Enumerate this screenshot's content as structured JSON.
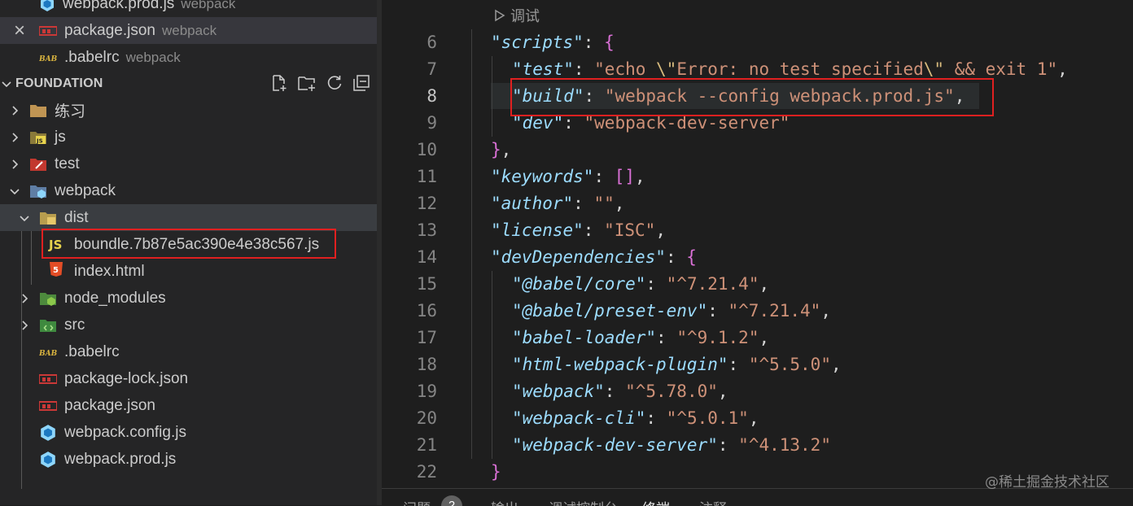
{
  "open_editors": [
    {
      "name": "webpack.prod.js",
      "desc": "webpack",
      "icon": "webpack-file-icon"
    },
    {
      "name": "package.json",
      "desc": "webpack",
      "icon": "npm-file-icon",
      "close": "×"
    },
    {
      "name": ".babelrc",
      "desc": "webpack",
      "icon": "babel-file-icon"
    }
  ],
  "explorer": {
    "title": "FOUNDATION",
    "actions": [
      "new-file-icon",
      "new-folder-icon",
      "refresh-icon",
      "collapse-all-icon"
    ],
    "items": [
      {
        "label": "练习",
        "icon": "folder-icon",
        "expanded": false
      },
      {
        "label": "js",
        "icon": "js-folder-icon",
        "expanded": false
      },
      {
        "label": "test",
        "icon": "test-folder-icon",
        "expanded": false
      },
      {
        "label": "webpack",
        "icon": "webpack-folder-icon",
        "expanded": true
      },
      {
        "label": "dist",
        "icon": "dist-folder-icon",
        "expanded": true
      },
      {
        "label": "boundle.7b87e5ac390e4e38c567.js",
        "icon": "js-file-icon",
        "badge": "JS"
      },
      {
        "label": "index.html",
        "icon": "html-file-icon",
        "badge": "5"
      },
      {
        "label": "node_modules",
        "icon": "node-folder-icon",
        "expanded": false
      },
      {
        "label": "src",
        "icon": "src-folder-icon",
        "expanded": false
      },
      {
        "label": ".babelrc",
        "icon": "babel-file-icon"
      },
      {
        "label": "package-lock.json",
        "icon": "npm-file-icon"
      },
      {
        "label": "package.json",
        "icon": "npm-file-icon"
      },
      {
        "label": "webpack.config.js",
        "icon": "webpack-file-icon"
      },
      {
        "label": "webpack.prod.js",
        "icon": "webpack-file-icon"
      }
    ]
  },
  "editor": {
    "codelens": "调试",
    "current_line": 8,
    "lines": [
      {
        "n": "6",
        "t": [
          [
            "k",
            "\"scripts\""
          ],
          [
            "p",
            ": "
          ],
          [
            "b1",
            "{"
          ]
        ]
      },
      {
        "n": "7",
        "t": [
          [
            "k",
            "\"test\""
          ],
          [
            "p",
            ": "
          ],
          [
            "s",
            "\"echo "
          ],
          [
            "esc",
            "\\\""
          ],
          [
            "s",
            "Error: no test specified"
          ],
          [
            "esc",
            "\\\""
          ],
          [
            "s",
            " && exit 1\""
          ],
          [
            "p",
            ","
          ]
        ]
      },
      {
        "n": "8",
        "t": [
          [
            "k",
            "\"build\""
          ],
          [
            "p",
            ": "
          ],
          [
            "s",
            "\"webpack --config webpack.prod.js\""
          ],
          [
            "p",
            ","
          ]
        ]
      },
      {
        "n": "9",
        "t": [
          [
            "k",
            "\"dev\""
          ],
          [
            "p",
            ": "
          ],
          [
            "s",
            "\"webpack-dev-server\""
          ]
        ]
      },
      {
        "n": "10",
        "t": [
          [
            "b1",
            "}"
          ],
          [
            "p",
            ","
          ]
        ]
      },
      {
        "n": "11",
        "t": [
          [
            "k",
            "\"keywords\""
          ],
          [
            "p",
            ": "
          ],
          [
            "b1",
            "[]"
          ],
          [
            "p",
            ","
          ]
        ]
      },
      {
        "n": "12",
        "t": [
          [
            "k",
            "\"author\""
          ],
          [
            "p",
            ": "
          ],
          [
            "s",
            "\"\""
          ],
          [
            "p",
            ","
          ]
        ]
      },
      {
        "n": "13",
        "t": [
          [
            "k",
            "\"license\""
          ],
          [
            "p",
            ": "
          ],
          [
            "s",
            "\"ISC\""
          ],
          [
            "p",
            ","
          ]
        ]
      },
      {
        "n": "14",
        "t": [
          [
            "k",
            "\"devDependencies\""
          ],
          [
            "p",
            ": "
          ],
          [
            "b1",
            "{"
          ]
        ]
      },
      {
        "n": "15",
        "t": [
          [
            "k",
            "\"@babel/core\""
          ],
          [
            "p",
            ": "
          ],
          [
            "s",
            "\"^7.21.4\""
          ],
          [
            "p",
            ","
          ]
        ]
      },
      {
        "n": "16",
        "t": [
          [
            "k",
            "\"@babel/preset-env\""
          ],
          [
            "p",
            ": "
          ],
          [
            "s",
            "\"^7.21.4\""
          ],
          [
            "p",
            ","
          ]
        ]
      },
      {
        "n": "17",
        "t": [
          [
            "k",
            "\"babel-loader\""
          ],
          [
            "p",
            ": "
          ],
          [
            "s",
            "\"^9.1.2\""
          ],
          [
            "p",
            ","
          ]
        ]
      },
      {
        "n": "18",
        "t": [
          [
            "k",
            "\"html-webpack-plugin\""
          ],
          [
            "p",
            ": "
          ],
          [
            "s",
            "\"^5.5.0\""
          ],
          [
            "p",
            ","
          ]
        ]
      },
      {
        "n": "19",
        "t": [
          [
            "k",
            "\"webpack\""
          ],
          [
            "p",
            ": "
          ],
          [
            "s",
            "\"^5.78.0\""
          ],
          [
            "p",
            ","
          ]
        ]
      },
      {
        "n": "20",
        "t": [
          [
            "k",
            "\"webpack-cli\""
          ],
          [
            "p",
            ": "
          ],
          [
            "s",
            "\"^5.0.1\""
          ],
          [
            "p",
            ","
          ]
        ]
      },
      {
        "n": "21",
        "t": [
          [
            "k",
            "\"webpack-dev-server\""
          ],
          [
            "p",
            ": "
          ],
          [
            "s",
            "\"^4.13.2\""
          ]
        ]
      },
      {
        "n": "22",
        "t": [
          [
            "b1",
            "}"
          ]
        ]
      }
    ]
  },
  "panel": {
    "tabs": [
      "问题",
      "输出",
      "调试控制台",
      "终端",
      "注释"
    ],
    "active": "终端",
    "problems_count": "2"
  },
  "watermark": "@稀土掘金技术社区",
  "colors": {
    "highlight_box": "#e02020",
    "json_key": "#9cdcfe",
    "json_string": "#ce9178",
    "bracket": "#da70d6"
  }
}
